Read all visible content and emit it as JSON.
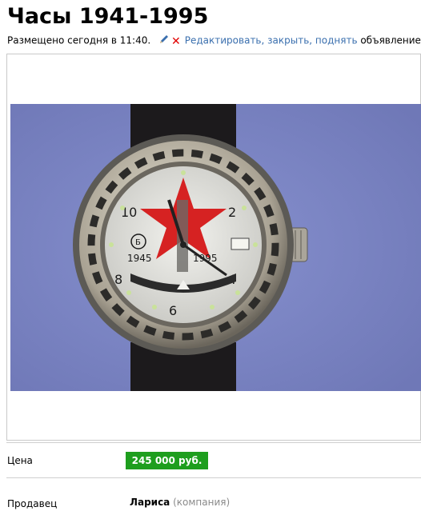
{
  "listing": {
    "title": "Часы 1941-1995",
    "posted_text": "Размещено сегодня в 11:40.",
    "manage_link": "Редактировать, закрыть, поднять",
    "manage_suffix": "объявление"
  },
  "photo": {
    "dial_year_left": "1945",
    "dial_year_right": "1995",
    "dial_numerals": [
      "10",
      "2",
      "8",
      "4",
      "6"
    ],
    "dial_logo": "Б"
  },
  "details": {
    "price_label": "Цена",
    "price_value": "245 000 руб.",
    "seller_label": "Продавец",
    "seller_name": "Лариса",
    "seller_type": "(компания)"
  },
  "colors": {
    "price_badge": "#1e9e1e",
    "link": "#3a6fae",
    "close_x": "#e10000",
    "photo_background": "#7c86c4"
  },
  "icons": [
    "pencil-icon",
    "close-icon"
  ]
}
